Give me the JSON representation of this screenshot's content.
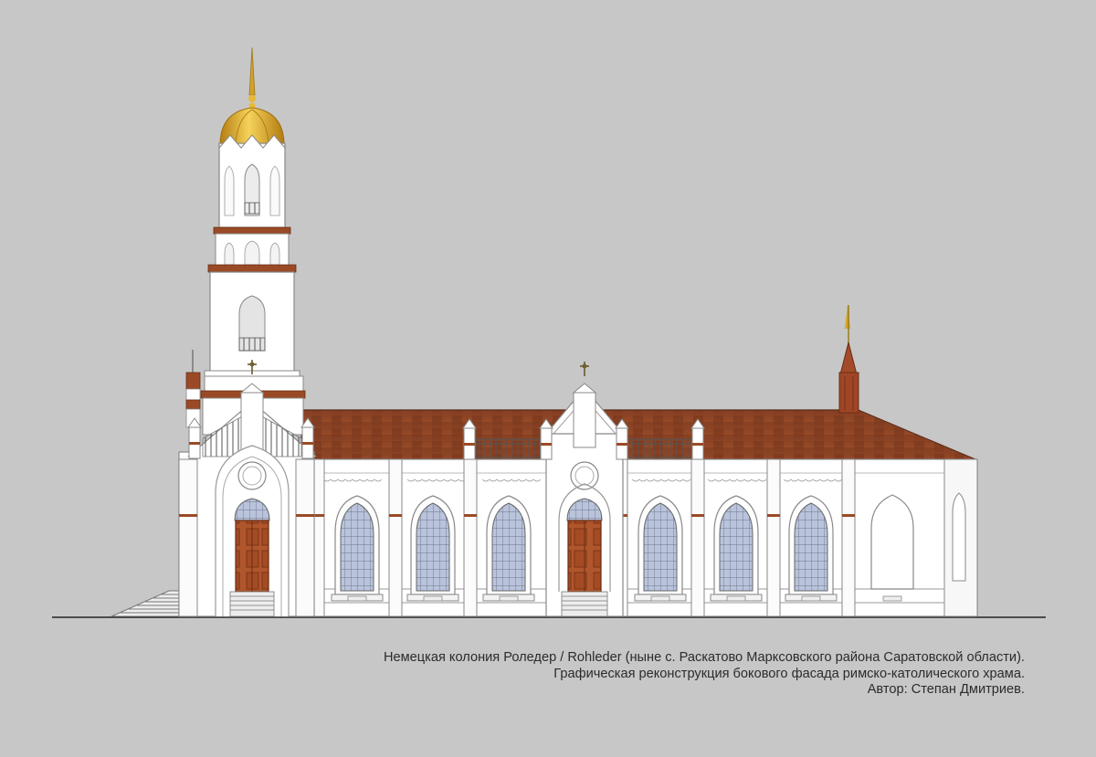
{
  "caption": {
    "line1": "Немецкая колония Роледер / Rohleder (ныне с. Раскатово Марксовского района Саратовской области).",
    "line2": "Графическая реконструкция бокового фасада римско-католического храма.",
    "line3": "Автор: Степан Дмитриев."
  },
  "colors": {
    "background": "#c7c7c7",
    "wall": "#ffffff",
    "roof": "#8a3f22",
    "dome": "#e0ad2a",
    "door": "#b0562c",
    "window_glass": "#b9c4dc",
    "outline": "#7a7a7a"
  }
}
